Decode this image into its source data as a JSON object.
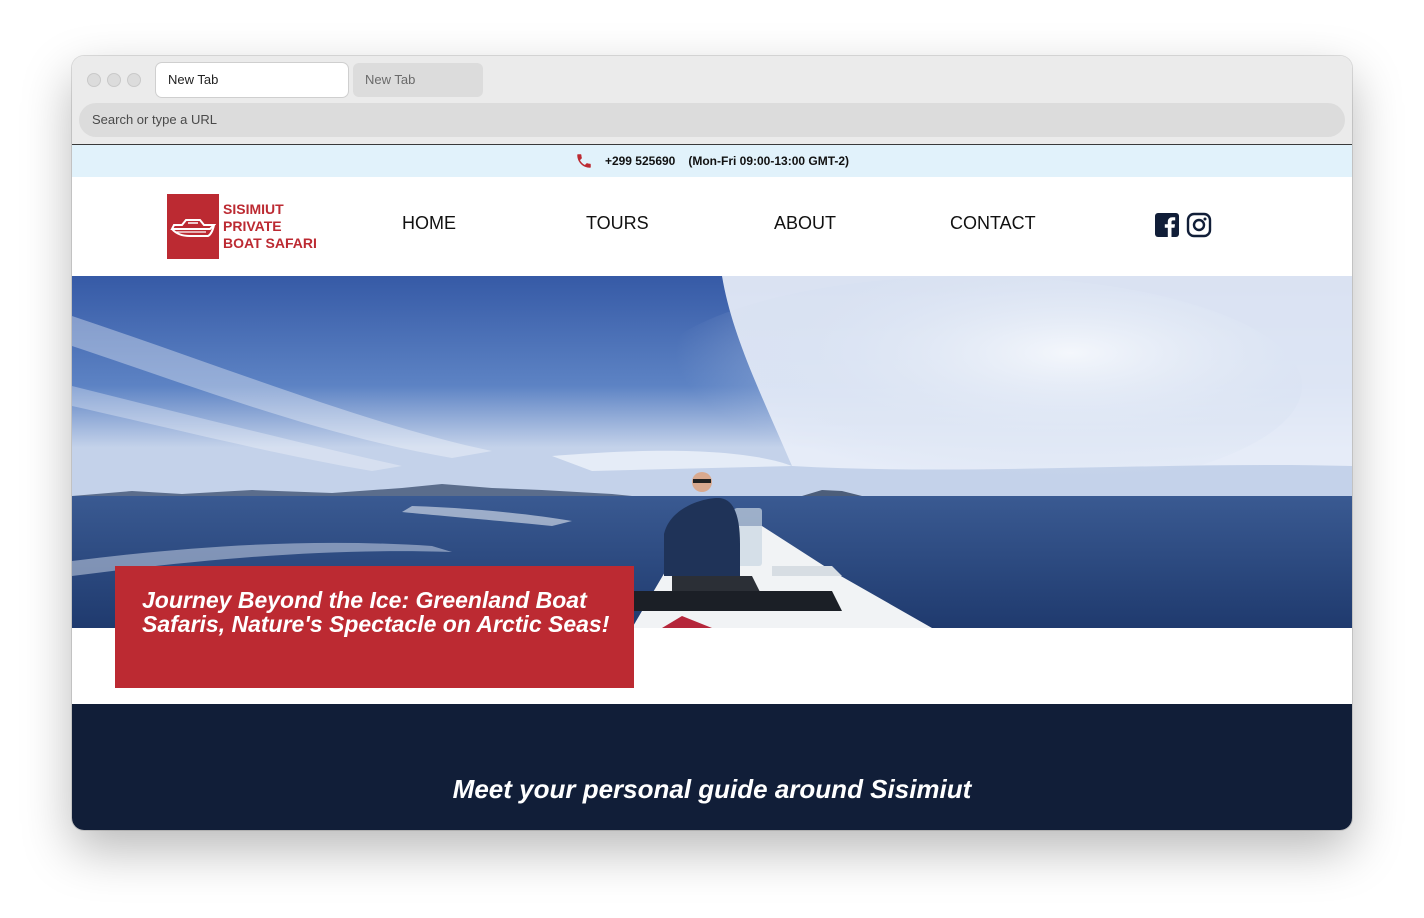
{
  "browser": {
    "tabs": [
      {
        "label": "New Tab",
        "active": true
      },
      {
        "label": "New Tab",
        "active": false
      }
    ],
    "url_placeholder": "Search or type a URL"
  },
  "topbar": {
    "phone": "+299 525690",
    "hours": "(Mon-Fri 09:00-13:00 GMT-2)"
  },
  "brand": {
    "line1": "SISIMIUT",
    "line2": "PRIVATE",
    "line3": "BOAT SAFARI",
    "color": "#bc2a32"
  },
  "nav": {
    "home": "HOME",
    "tours": "TOURS",
    "about": "ABOUT",
    "contact": "CONTACT"
  },
  "social": [
    "facebook-icon",
    "instagram-icon"
  ],
  "hero": {
    "headline": "Journey Beyond the Ice: Greenland Boat Safaris, Nature's Spectacle on Arctic Seas!"
  },
  "section": {
    "title": "Meet your personal guide around Sisimiut"
  },
  "colors": {
    "accent_red": "#bc2a32",
    "navy": "#111e38",
    "topbar_bg": "#e1f2fb"
  }
}
